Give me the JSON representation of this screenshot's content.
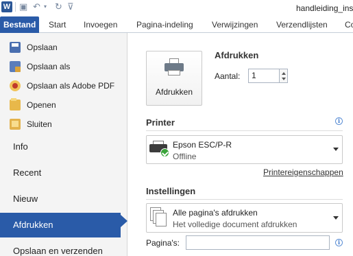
{
  "titlebar": {
    "app_icon": "W",
    "document_title": "handleiding_ins"
  },
  "quick_access": {
    "icons": [
      "save-icon",
      "undo-icon",
      "redo-icon",
      "customize-icon"
    ]
  },
  "tabs": [
    {
      "label": "Bestand",
      "active": true
    },
    {
      "label": "Start"
    },
    {
      "label": "Invoegen"
    },
    {
      "label": "Pagina-indeling"
    },
    {
      "label": "Verwijzingen"
    },
    {
      "label": "Verzendlijsten"
    },
    {
      "label": "Co"
    }
  ],
  "nav": {
    "commands": [
      {
        "label": "Opslaan",
        "icon": "save-icon"
      },
      {
        "label": "Opslaan als",
        "icon": "save-as-icon"
      },
      {
        "label": "Opslaan als Adobe PDF",
        "icon": "pdf-icon"
      },
      {
        "label": "Openen",
        "icon": "open-folder-icon"
      },
      {
        "label": "Sluiten",
        "icon": "close-folder-icon"
      }
    ],
    "sections": [
      {
        "label": "Info"
      },
      {
        "label": "Recent"
      },
      {
        "label": "Nieuw"
      },
      {
        "label": "Afdrukken",
        "active": true
      },
      {
        "label": "Opslaan en verzenden"
      }
    ]
  },
  "print": {
    "heading": "Afdrukken",
    "button_label": "Afdrukken",
    "copies_label": "Aantal:",
    "copies_value": "1"
  },
  "printer": {
    "heading": "Printer",
    "name": "Epson ESC/P-R",
    "status": "Offline",
    "properties_link": "Printereigenschappen"
  },
  "settings": {
    "heading": "Instellingen",
    "range_title": "Alle pagina's afdrukken",
    "range_subtitle": "Het volledige document afdrukken",
    "pages_label": "Pagina's:",
    "pages_value": ""
  },
  "colors": {
    "accent": "#2a5ba8",
    "ok_badge": "#3aa43a"
  }
}
